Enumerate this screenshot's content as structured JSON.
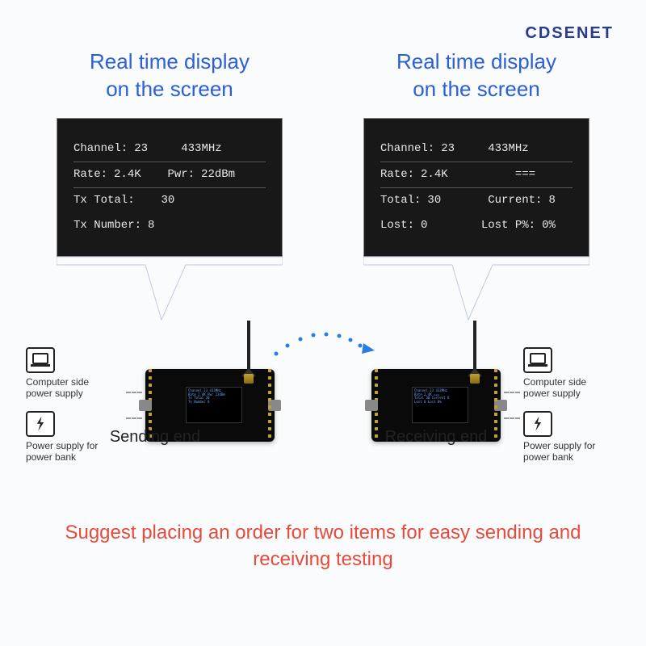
{
  "brand": "CDSENET",
  "panels": {
    "sending": {
      "title": "Real time display\non the screen",
      "lines": [
        {
          "k": "Channel:",
          "v1": "23",
          "v2": "433MHz",
          "underline": true
        },
        {
          "k": "Rate:",
          "v1": "2.4K",
          "k2": "Pwr:",
          "v2": "22dBm",
          "underline": true
        },
        {
          "k": "Tx Total:",
          "v1": "30"
        },
        {
          "k": "Tx Number:",
          "v1": "8"
        }
      ],
      "caption": "Sending end"
    },
    "receiving": {
      "title": "Real time display\non the screen",
      "lines": [
        {
          "k": "Channel:",
          "v1": "23",
          "v2": "433MHz",
          "underline": true
        },
        {
          "k": "Rate:",
          "v1": "2.4K",
          "v2": "===",
          "underline": true
        },
        {
          "k": "Total:",
          "v1": "30",
          "k2": "Current:",
          "v2": "8"
        },
        {
          "k": "Lost:",
          "v1": "0",
          "k2": "Lost P%:",
          "v2": "0%"
        }
      ],
      "caption": "Receiving end"
    }
  },
  "side": {
    "computer": "Computer side\npower supply",
    "bank": "Power supply for\npower bank"
  },
  "suggest": "Suggest placing an order for two items for easy sending and receiving testing"
}
